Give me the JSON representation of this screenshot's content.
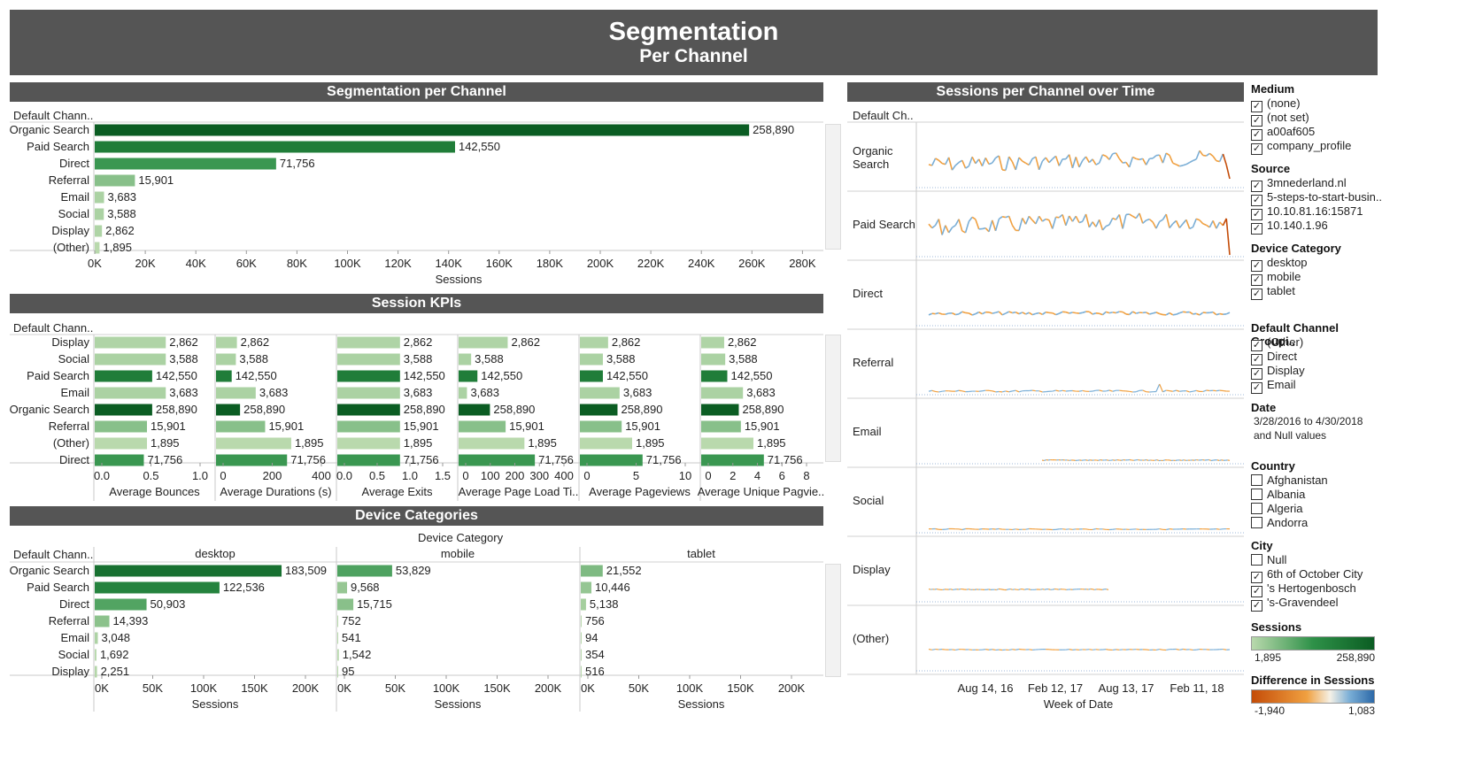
{
  "header": {
    "title": "Segmentation",
    "subtitle": "Per Channel"
  },
  "colors": {
    "header_bg": "#555555",
    "dark_green": "#0b5d23",
    "light_green": "#b4d6a8",
    "line_blue": "#7aaed6",
    "line_orange": "#f0a040"
  },
  "seg": {
    "title": "Segmentation per Channel",
    "row_header": "Default Chann..",
    "axis_title": "Sessions",
    "ticks": [
      "0K",
      "20K",
      "40K",
      "60K",
      "80K",
      "100K",
      "120K",
      "140K",
      "160K",
      "180K",
      "200K",
      "220K",
      "240K",
      "260K",
      "280K"
    ],
    "chart_data": {
      "type": "bar",
      "categories": [
        "Organic Search",
        "Paid Search",
        "Direct",
        "Referral",
        "Email",
        "Social",
        "Display",
        "(Other)"
      ],
      "values": [
        258890,
        142550,
        71756,
        15901,
        3683,
        3588,
        2862,
        1895
      ],
      "labels": [
        "258,890",
        "142,550",
        "71,756",
        "15,901",
        "3,683",
        "3,588",
        "2,862",
        "1,895"
      ],
      "xlim": [
        0,
        290000
      ]
    }
  },
  "kpi": {
    "title": "Session KPIs",
    "row_header": "Default Chann..",
    "categories": [
      "Display",
      "Social",
      "Paid Search",
      "Email",
      "Organic Search",
      "Referral",
      "(Other)",
      "Direct"
    ],
    "values": [
      2862,
      3588,
      142550,
      3683,
      258890,
      15901,
      1895,
      71756
    ],
    "labels": [
      "2,862",
      "3,588",
      "142,550",
      "3,683",
      "258,890",
      "15,901",
      "1,895",
      "71,756"
    ],
    "panels": [
      {
        "title": "Average Bounces",
        "ticks": [
          "0.0",
          "0.5",
          "1.0"
        ],
        "bars": [
          0.68,
          0.68,
          0.55,
          0.68,
          0.55,
          0.5,
          0.5,
          0.47
        ]
      },
      {
        "title": "Average Durations (s)",
        "ticks": [
          "0",
          "200",
          "400"
        ],
        "bars": [
          0.2,
          0.19,
          0.15,
          0.38,
          0.23,
          0.47,
          0.72,
          0.68
        ]
      },
      {
        "title": "Average Exits",
        "ticks": [
          "0.0",
          "0.5",
          "1.0",
          "1.5"
        ],
        "bars": [
          0.6,
          0.6,
          0.6,
          0.6,
          0.6,
          0.6,
          0.6,
          0.6
        ]
      },
      {
        "title": "Average Page Load Ti..",
        "ticks": [
          "0",
          "100",
          "200",
          "300",
          "400"
        ],
        "bars": [
          0.47,
          0.12,
          0.18,
          0.08,
          0.3,
          0.45,
          0.63,
          0.73
        ]
      },
      {
        "title": "Average Pageviews",
        "ticks": [
          "0",
          "5",
          "10"
        ],
        "bars": [
          0.27,
          0.22,
          0.22,
          0.38,
          0.36,
          0.4,
          0.5,
          0.6
        ]
      },
      {
        "title": "Average Unique Pagvie..",
        "ticks": [
          "0",
          "2",
          "4",
          "6",
          "8"
        ],
        "bars": [
          0.22,
          0.23,
          0.25,
          0.4,
          0.36,
          0.38,
          0.5,
          0.6
        ]
      }
    ]
  },
  "device": {
    "title": "Device Categories",
    "col_header": "Device Category",
    "row_header": "Default Chann..",
    "axis_title": "Sessions",
    "categories": [
      "Organic Search",
      "Paid Search",
      "Direct",
      "Referral",
      "Email",
      "Social",
      "Display"
    ],
    "ticks": [
      "0K",
      "50K",
      "100K",
      "150K",
      "200K"
    ],
    "xlim": [
      0,
      250000
    ],
    "columns": [
      {
        "name": "desktop",
        "values": [
          183509,
          122536,
          50903,
          14393,
          3048,
          1692,
          2251
        ],
        "labels": [
          "183,509",
          "122,536",
          "50,903",
          "14,393",
          "3,048",
          "1,692",
          "2,251"
        ]
      },
      {
        "name": "mobile",
        "values": [
          53829,
          9568,
          15715,
          752,
          541,
          1542,
          95
        ],
        "labels": [
          "53,829",
          "9,568",
          "15,715",
          "752",
          "541",
          "1,542",
          "95"
        ]
      },
      {
        "name": "tablet",
        "values": [
          21552,
          10446,
          5138,
          756,
          94,
          354,
          516
        ],
        "labels": [
          "21,552",
          "10,446",
          "5,138",
          "756",
          "94",
          "354",
          "516"
        ]
      }
    ]
  },
  "time": {
    "title": "Sessions per Channel over Time",
    "row_header": "Default Ch..",
    "axis_title": "Week of Date",
    "ticks": [
      "Aug 14, 16",
      "Feb 12, 17",
      "Aug 13, 17",
      "Feb 11, 18"
    ],
    "rows": [
      "Organic Search",
      "Paid Search",
      "Direct",
      "Referral",
      "Email",
      "Social",
      "Display",
      "(Other)"
    ]
  },
  "filters": {
    "medium": {
      "title": "Medium",
      "items": [
        "(none)",
        "(not set)",
        "a00af605",
        "company_profile"
      ],
      "checked": [
        true,
        true,
        true,
        true
      ]
    },
    "source": {
      "title": "Source",
      "items": [
        "3mnederland.nl",
        "5-steps-to-start-busin..",
        "10.10.81.16:15871",
        "10.140.1.96"
      ],
      "checked": [
        true,
        true,
        true,
        true
      ]
    },
    "device": {
      "title": "Device Category",
      "items": [
        "desktop",
        "mobile",
        "tablet"
      ],
      "checked": [
        true,
        true,
        true
      ]
    },
    "channel": {
      "title": "Default Channel Groupi..",
      "items": [
        "(Other)",
        "Direct",
        "Display",
        "Email"
      ],
      "checked": [
        true,
        true,
        true,
        true
      ]
    },
    "date": {
      "title": "Date",
      "line1": "3/28/2016 to 4/30/2018",
      "line2": "and Null values"
    },
    "country": {
      "title": "Country",
      "items": [
        "Afghanistan",
        "Albania",
        "Algeria",
        "Andorra"
      ],
      "checked": [
        false,
        false,
        false,
        false
      ]
    },
    "city": {
      "title": "City",
      "items": [
        "Null",
        "6th of October City",
        "'s Hertogenbosch",
        "'s-Gravendeel"
      ],
      "checked": [
        false,
        true,
        true,
        true
      ]
    }
  },
  "legend": {
    "sessions": {
      "title": "Sessions",
      "min": "1,895",
      "max": "258,890"
    },
    "difference": {
      "title": "Difference in Sessions",
      "min": "-1,940",
      "max": "1,083"
    }
  }
}
